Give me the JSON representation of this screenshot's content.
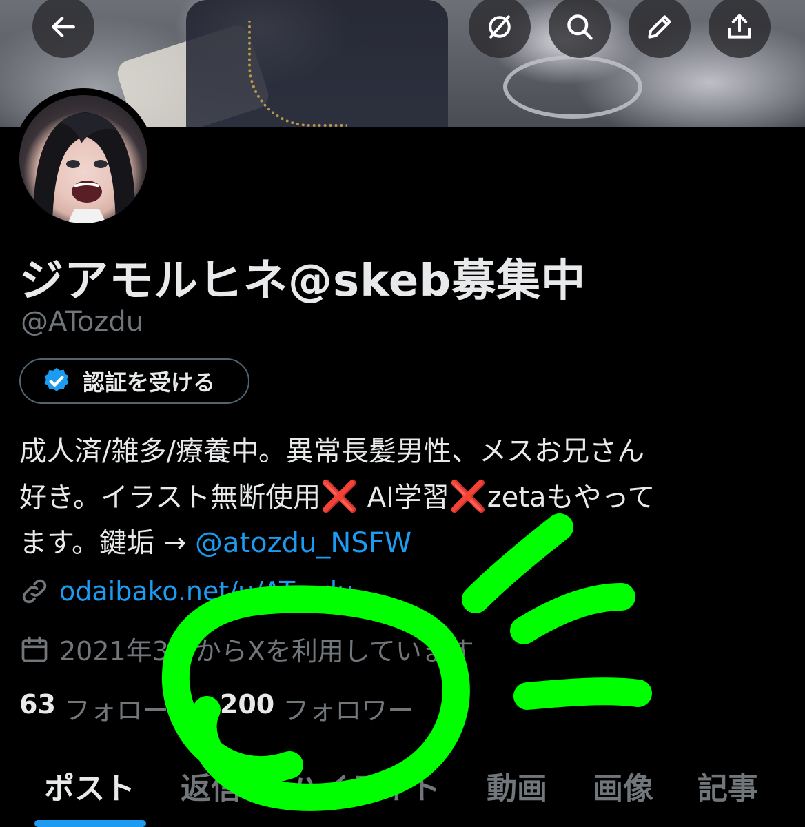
{
  "header": {
    "back_icon": "back-arrow-icon",
    "actions": [
      "grok-icon",
      "search-icon",
      "edit-icon",
      "share-icon"
    ]
  },
  "profile": {
    "display_name": "ジアモルヒネ@skeb募集中",
    "handle": "@ATozdu",
    "verify_button_label": "認証を受ける",
    "bio_line1": "成人済/雑多/療養中。異常長髪男性、メスお兄さん",
    "bio_line2_a": "好き。イラスト無断使用",
    "bio_line2_b": "AI学習",
    "bio_line2_c": "zetaもやって",
    "bio_line3_a": "ます。鍵垢 →",
    "bio_mention": "@atozdu_NSFW",
    "bio_xmark": "❌",
    "website": "odaibako.net/u/ATozdu",
    "joined": "2021年3月からXを利用しています",
    "following_count": "63",
    "following_label": "フォロー中",
    "followers_count": "200",
    "followers_label": "フォロワー"
  },
  "tabs": [
    "ポスト",
    "返信",
    "ハイライト",
    "動画",
    "画像",
    "記事"
  ],
  "colors": {
    "background": "#000000",
    "accent": "#1d9bf0",
    "text_primary": "#e7e9ea",
    "text_secondary": "#71767b",
    "annotation_scribble": "#00ff00",
    "xmark": "#e0245e"
  }
}
